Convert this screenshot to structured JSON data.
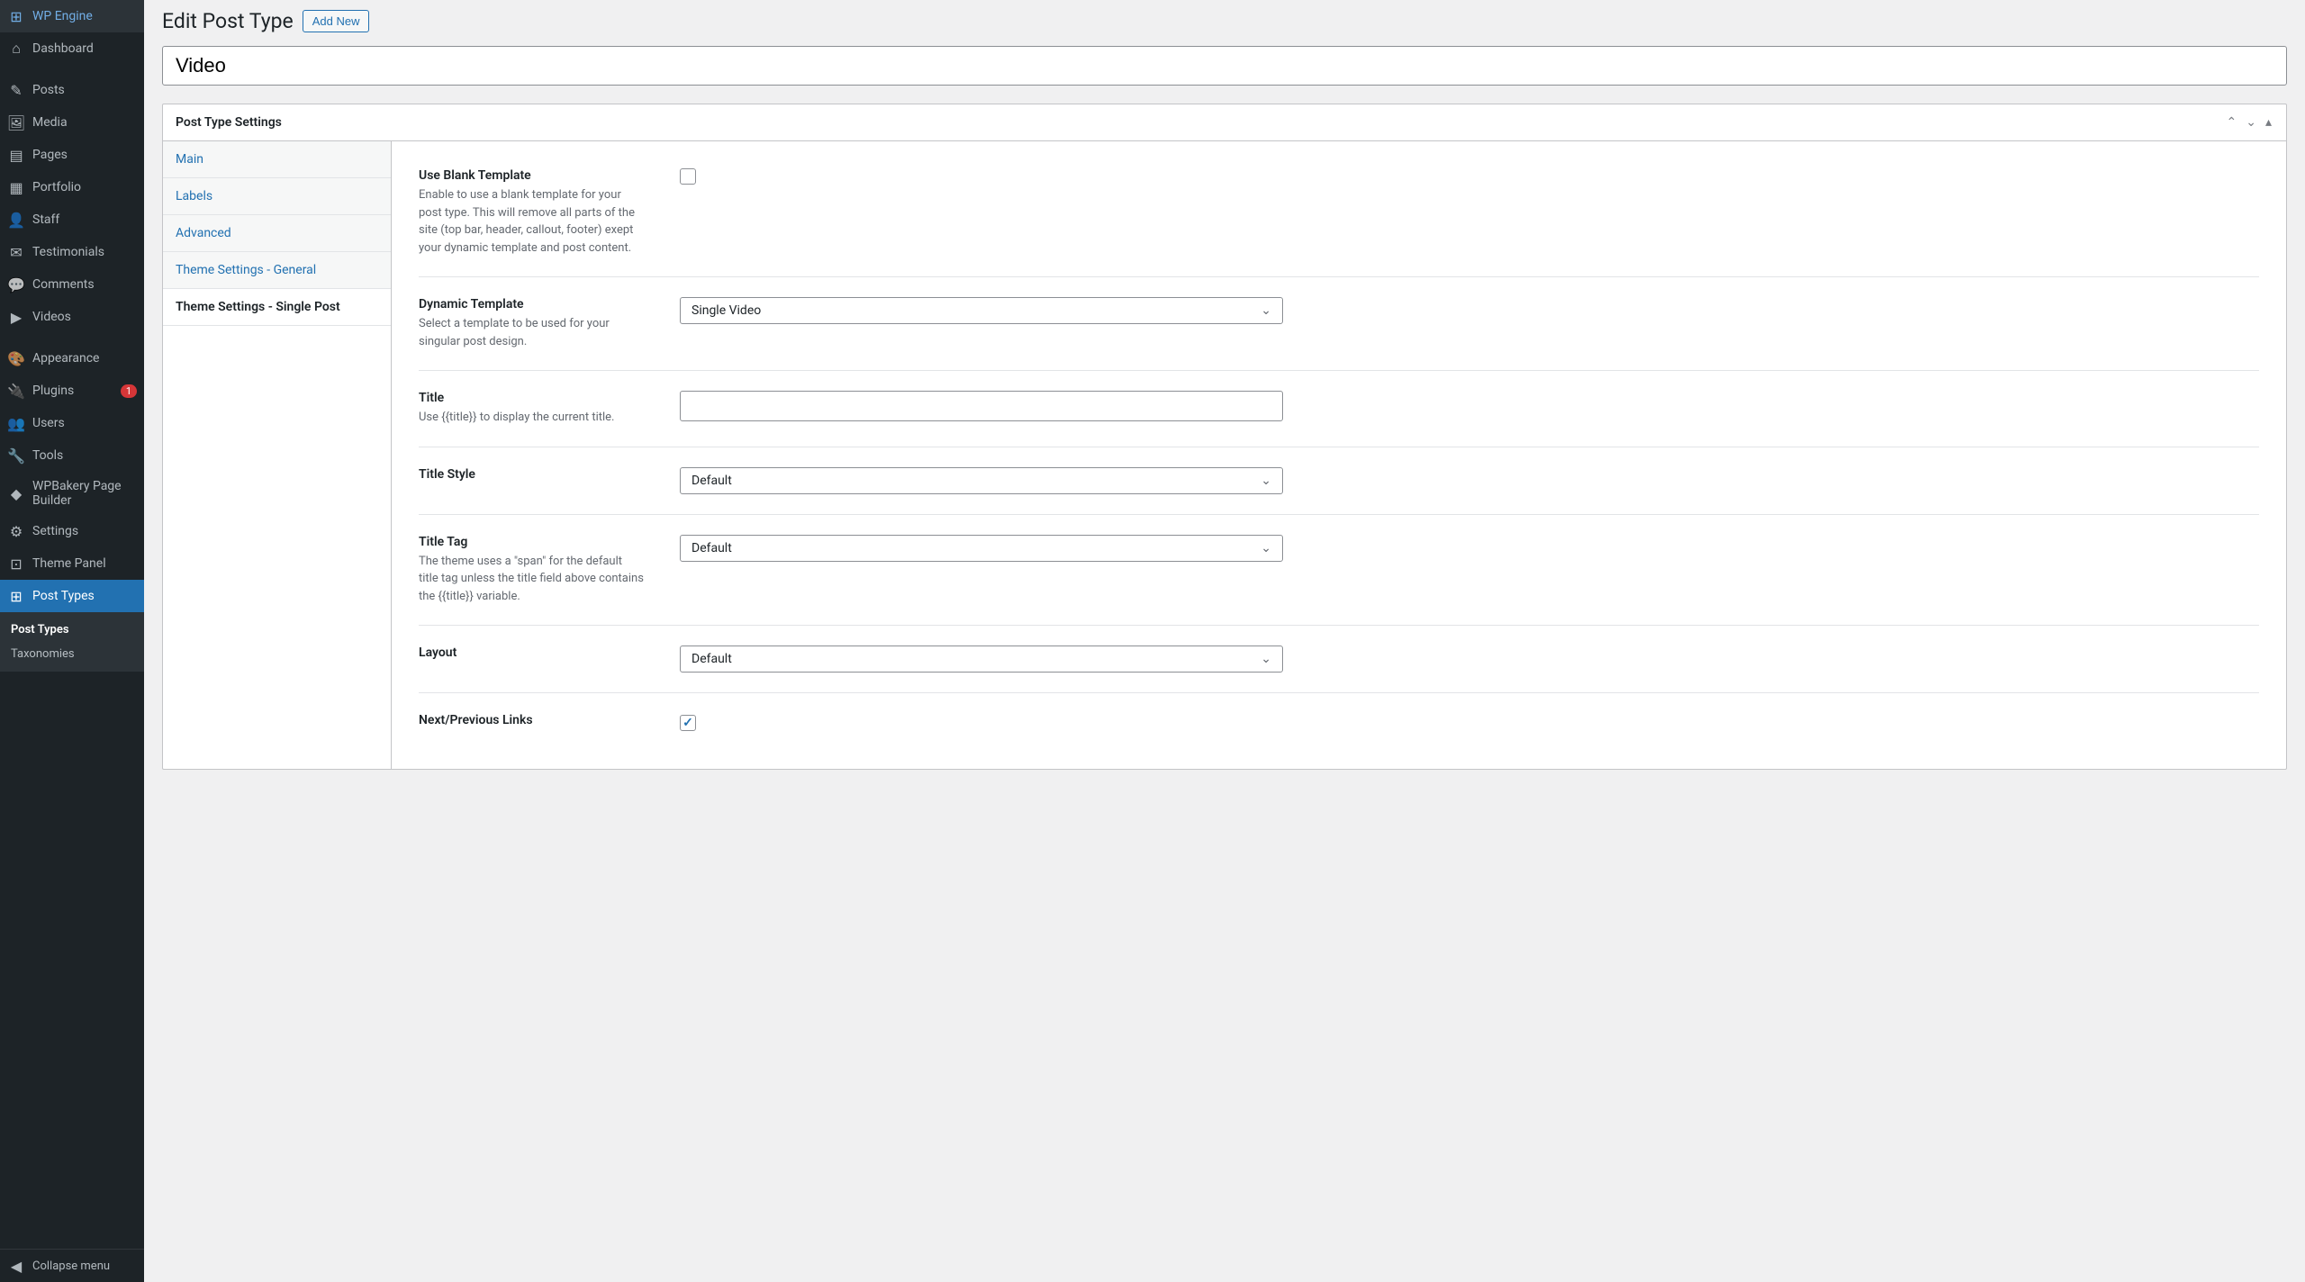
{
  "sidebar": {
    "items": [
      {
        "label": "WP Engine",
        "icon": "⊞"
      },
      {
        "label": "Dashboard",
        "icon": "⌂"
      },
      {
        "label": "Posts",
        "icon": "✎"
      },
      {
        "label": "Media",
        "icon": "🖼"
      },
      {
        "label": "Pages",
        "icon": "▤"
      },
      {
        "label": "Portfolio",
        "icon": "▦"
      },
      {
        "label": "Staff",
        "icon": "👤"
      },
      {
        "label": "Testimonials",
        "icon": "✉"
      },
      {
        "label": "Comments",
        "icon": "💬"
      },
      {
        "label": "Videos",
        "icon": "▶"
      },
      {
        "label": "Appearance",
        "icon": "🎨"
      },
      {
        "label": "Plugins",
        "icon": "🔌",
        "badge": "1"
      },
      {
        "label": "Users",
        "icon": "👥"
      },
      {
        "label": "Tools",
        "icon": "🔧"
      },
      {
        "label": "WPBakery Page Builder",
        "icon": "◆"
      },
      {
        "label": "Settings",
        "icon": "⚙"
      },
      {
        "label": "Theme Panel",
        "icon": "⊡"
      },
      {
        "label": "Post Types",
        "icon": "⊞",
        "active": true
      }
    ],
    "sub_items": [
      {
        "label": "Post Types",
        "active": true
      },
      {
        "label": "Taxonomies"
      }
    ],
    "collapse": "Collapse menu"
  },
  "page": {
    "title": "Edit Post Type",
    "add_new": "Add New",
    "name_value": "Video"
  },
  "panel": {
    "title": "Post Type Settings",
    "tabs": [
      {
        "label": "Main"
      },
      {
        "label": "Labels"
      },
      {
        "label": "Advanced"
      },
      {
        "label": "Theme Settings - General"
      },
      {
        "label": "Theme Settings - Single Post",
        "active": true
      }
    ]
  },
  "fields": {
    "blank_template": {
      "label": "Use Blank Template",
      "desc": "Enable to use a blank template for your post type. This will remove all parts of the site (top bar, header, callout, footer) exept your dynamic template and post content.",
      "checked": false
    },
    "dynamic_template": {
      "label": "Dynamic Template",
      "desc": "Select a template to be used for your singular post design.",
      "value": "Single Video"
    },
    "title": {
      "label": "Title",
      "desc": "Use {{title}} to display the current title.",
      "value": ""
    },
    "title_style": {
      "label": "Title Style",
      "value": "Default"
    },
    "title_tag": {
      "label": "Title Tag",
      "desc": "The theme uses a \"span\" for the default title tag unless the title field above contains the {{title}} variable.",
      "value": "Default"
    },
    "layout": {
      "label": "Layout",
      "value": "Default"
    },
    "next_prev": {
      "label": "Next/Previous Links",
      "checked": true
    }
  }
}
